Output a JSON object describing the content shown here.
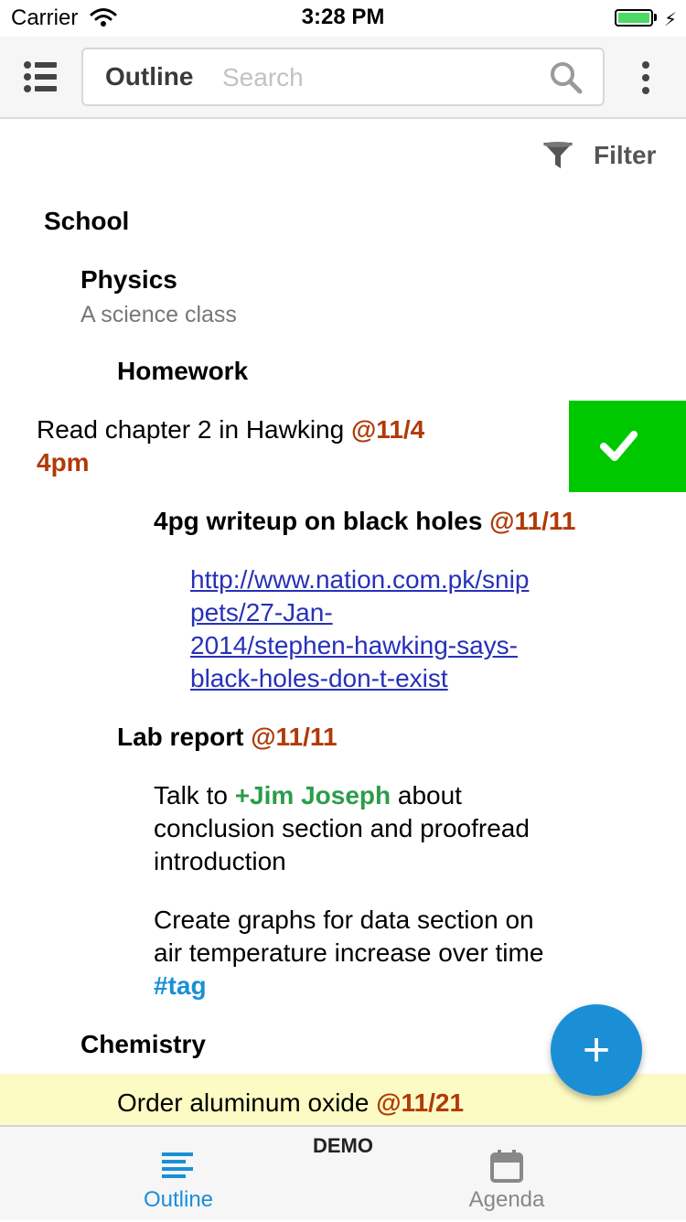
{
  "status_bar": {
    "carrier": "Carrier",
    "time": "3:28 PM"
  },
  "top_bar": {
    "mode_label": "Outline",
    "search_placeholder": "Search"
  },
  "filter": {
    "label": "Filter"
  },
  "outline": {
    "school": "School",
    "physics": {
      "title": "Physics",
      "note": "A science class"
    },
    "homework": "Homework",
    "read_task": {
      "text": "Read chapter 2 in Hawking ",
      "date": "@11/4",
      "time": "4pm"
    },
    "writeup": {
      "text": "4pg writeup on black holes ",
      "date": "@11/11"
    },
    "link": "http://www.nation.com.pk/snippets/27-Jan-2014/stephen-hawking-says-black-holes-don-t-exist",
    "link_lines": [
      "http://www.nation.com.pk/snip",
      "pets/27-Jan-",
      "2014/stephen-hawking-says-",
      "black-holes-don-t-exist"
    ],
    "lab_report": {
      "text": "Lab report ",
      "date": "@11/11"
    },
    "talk_task": {
      "prefix": "Talk to ",
      "contact": "+Jim Joseph",
      "suffix": " about",
      "line2": "conclusion section and proofread",
      "line3": "introduction"
    },
    "graphs_task": {
      "line1": "Create graphs for data section on",
      "line2": "air temperature increase over time",
      "tag": "#tag"
    },
    "chemistry": "Chemistry",
    "order_task": {
      "text": "Order aluminum oxide ",
      "date": "@11/21"
    }
  },
  "tab_bar": {
    "demo_label": "DEMO",
    "tabs": [
      {
        "label": "Outline",
        "icon": "outline-list-icon",
        "active": true
      },
      {
        "label": "Agenda",
        "icon": "calendar-icon",
        "active": false
      }
    ]
  },
  "colors": {
    "accent": "#1a8fd6",
    "date": "#b03a08",
    "contact": "#2c9c4a",
    "complete_action": "#00c800",
    "highlight": "#fdfbc4"
  }
}
